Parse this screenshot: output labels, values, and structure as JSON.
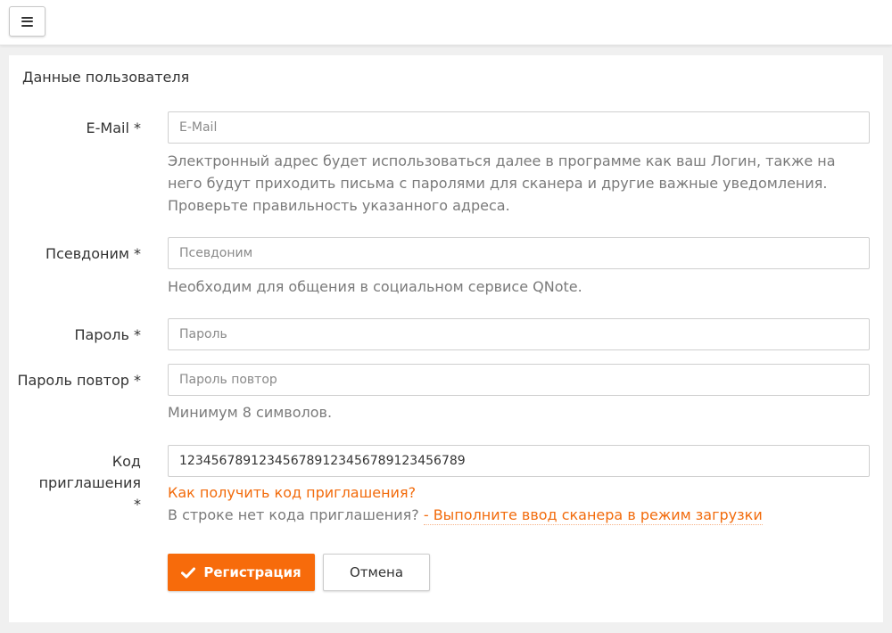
{
  "header": {
    "menu_icon": "hamburger-menu-icon"
  },
  "panel": {
    "title": "Данные пользователя"
  },
  "form": {
    "email": {
      "label": "E-Mail *",
      "placeholder": "E-Mail",
      "value": "",
      "help": "Электронный адрес будет использоваться далее в программе как ваш Логин, также на него будут приходить письма с паролями для сканера и другие важные уведомления. Проверьте правильность указанного адреса."
    },
    "nickname": {
      "label": "Псевдоним *",
      "placeholder": "Псевдоним",
      "value": "",
      "help": "Необходим для общения в социальном сервисе QNote."
    },
    "password": {
      "label": "Пароль *",
      "placeholder": "Пароль",
      "value": ""
    },
    "password_repeat": {
      "label": "Пароль повтор *",
      "placeholder": "Пароль повтор",
      "value": "",
      "help": "Минимум 8 символов."
    },
    "invite_code": {
      "label": "Код приглашения *",
      "placeholder": "",
      "value": "123456789123456789123456789123456789",
      "how_to_link": "Как получить код приглашения?",
      "missing_text": "В строке нет кода приглашения?",
      "scanner_link": "- Выполните ввод сканера в режим загрузки"
    }
  },
  "actions": {
    "register_label": "Регистрация",
    "register_icon": "checkmark-icon",
    "cancel_label": "Отмена"
  },
  "colors": {
    "accent": "#f76b0b",
    "link": "#f26b0c",
    "help_text": "#7a7a7a"
  }
}
